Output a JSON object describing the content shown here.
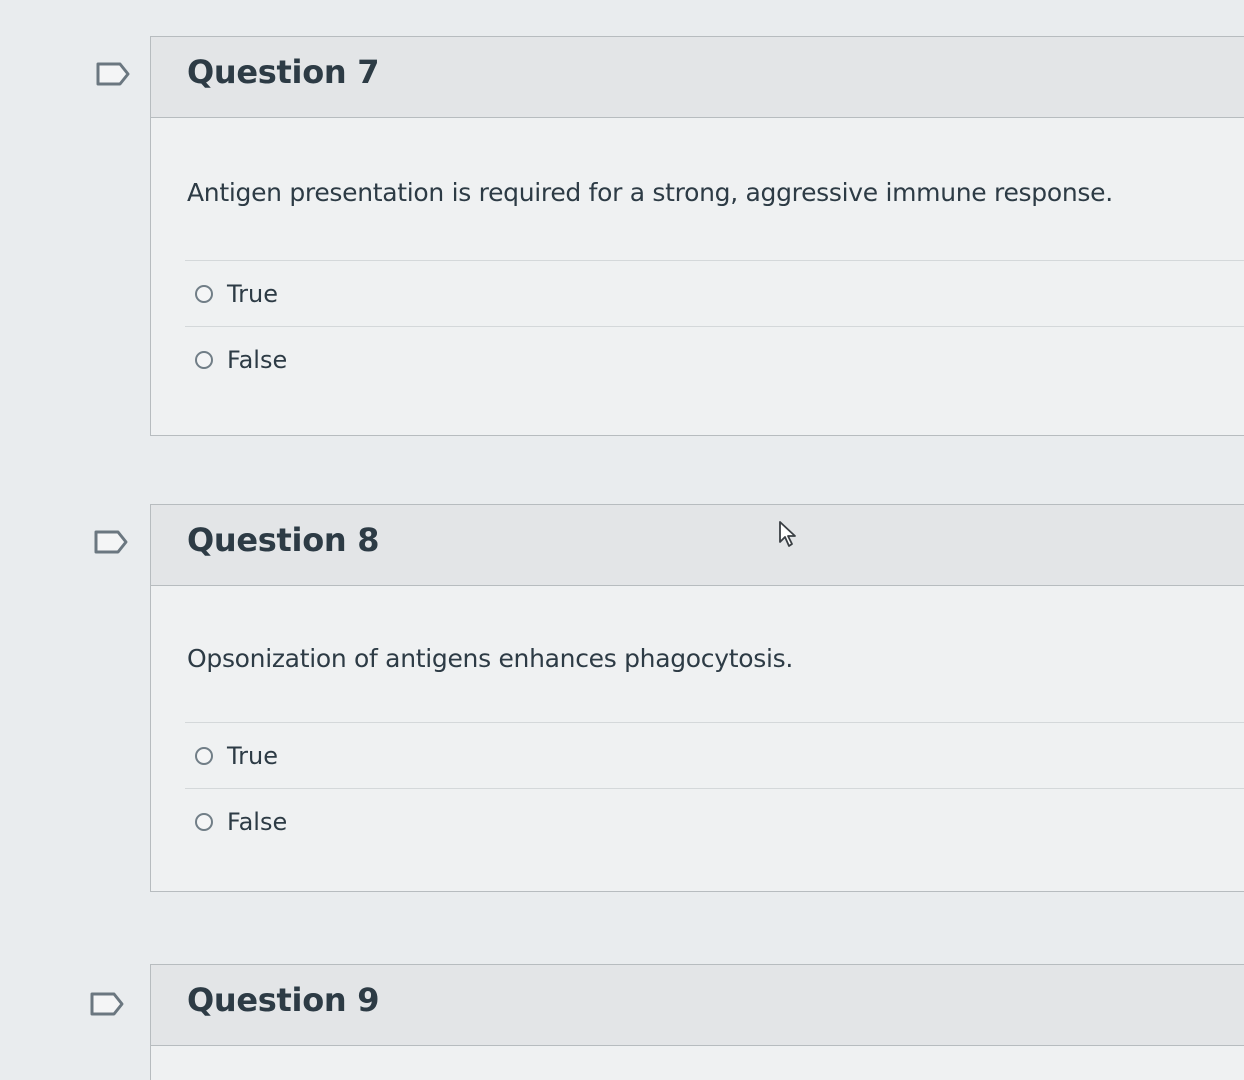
{
  "questions": [
    {
      "title": "Question 7",
      "text": "Antigen presentation is required for a strong, aggressive immune response.",
      "answers": [
        "True",
        "False"
      ]
    },
    {
      "title": "Question 8",
      "text": "Opsonization of antigens enhances phagocytosis.",
      "answers": [
        "True",
        "False"
      ]
    },
    {
      "title": "Question 9"
    }
  ],
  "icons": {
    "flag": "bookmark-flag-icon",
    "cursor": "mouse-pointer-icon"
  }
}
